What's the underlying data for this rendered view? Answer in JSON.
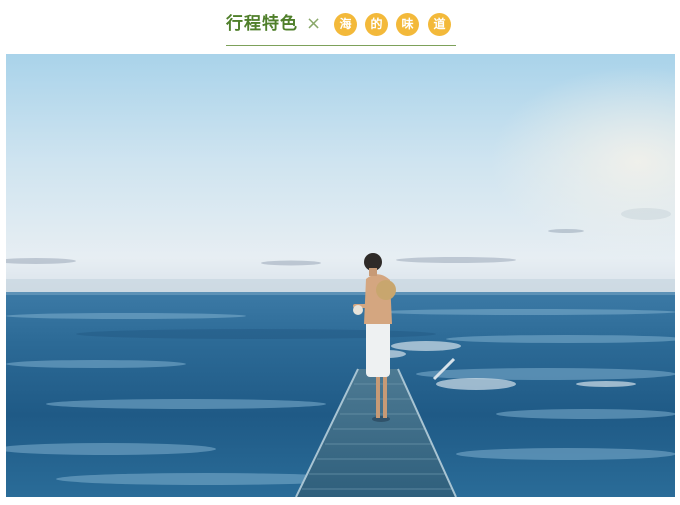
{
  "header": {
    "title": "行程特色",
    "separator": "×",
    "circle_chars": [
      "海",
      "的",
      "味",
      "道"
    ],
    "title_color": "#4f7f2a",
    "circle_color": "#f3b93a"
  },
  "photo": {
    "subject": "person-standing-on-pier-icon"
  }
}
